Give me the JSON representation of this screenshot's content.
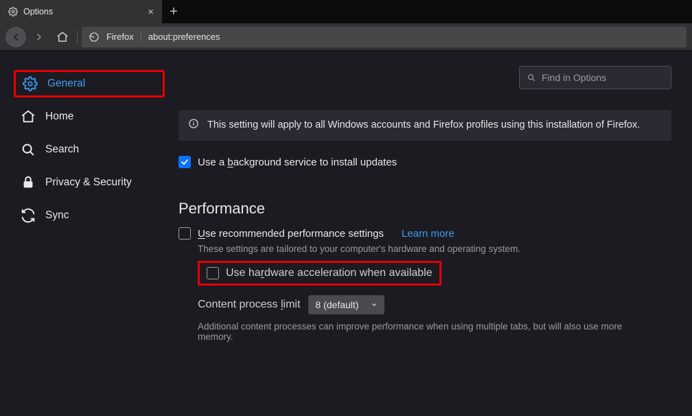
{
  "tab": {
    "title": "Options"
  },
  "urlbar": {
    "identity": "Firefox",
    "url": "about:preferences"
  },
  "search": {
    "placeholder": "Find in Options"
  },
  "sidebar": {
    "items": [
      {
        "label": "General"
      },
      {
        "label": "Home"
      },
      {
        "label": "Search"
      },
      {
        "label": "Privacy & Security"
      },
      {
        "label": "Sync"
      }
    ]
  },
  "banner": {
    "text": "This setting will apply to all Windows accounts and Firefox profiles using this installation of Firefox."
  },
  "background_service": {
    "prefix": "Use a ",
    "underlined": "b",
    "suffix": "ackground service to install updates"
  },
  "perf": {
    "heading": "Performance",
    "recommended_prefix": "U",
    "recommended_suffix": "se recommended performance settings",
    "learn_more": "Learn more",
    "tailored": "These settings are tailored to your computer's hardware and operating system.",
    "hw_prefix": "Use ha",
    "hw_under": "r",
    "hw_suffix": "dware acceleration when available",
    "limit_prefix": "Content process ",
    "limit_under": "l",
    "limit_suffix": "imit",
    "limit_value": "8 (default)",
    "note": "Additional content processes can improve performance when using multiple tabs, but will also use more memory."
  }
}
